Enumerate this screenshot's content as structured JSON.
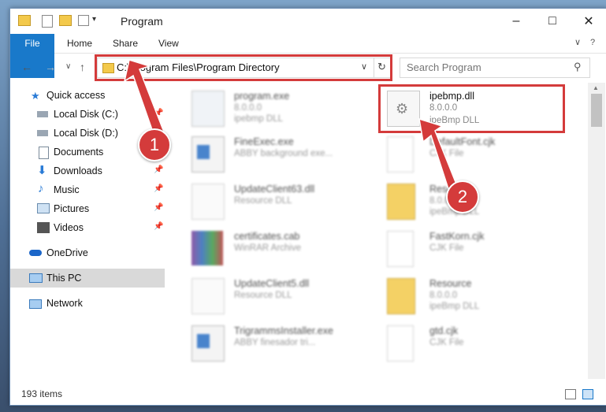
{
  "window": {
    "title": "Program"
  },
  "ribbon": {
    "tabs": [
      "File",
      "Home",
      "Share",
      "View"
    ]
  },
  "address": {
    "path": "C:\\Program Files\\Program Directory"
  },
  "search": {
    "placeholder": "Search Program"
  },
  "nav": {
    "items": [
      {
        "label": "Quick access"
      },
      {
        "label": "Local Disk (C:)"
      },
      {
        "label": "Local Disk (D:)"
      },
      {
        "label": "Documents"
      },
      {
        "label": "Downloads"
      },
      {
        "label": "Music"
      },
      {
        "label": "Pictures"
      },
      {
        "label": "Videos"
      },
      {
        "label": "OneDrive"
      },
      {
        "label": "This PC"
      },
      {
        "label": "Network"
      }
    ]
  },
  "files": {
    "left": [
      {
        "name": "program.exe",
        "line1": "8.0.0.0",
        "line2": "ipebmp DLL"
      },
      {
        "name": "FineExec.exe",
        "line1": "ABBY background exe..."
      },
      {
        "name": "UpdateClient63.dll",
        "line1": "Resource DLL"
      },
      {
        "name": "certificates.cab",
        "line1": "WinRAR Archive"
      },
      {
        "name": "UpdateClient5.dll",
        "line1": "Resource DLL"
      },
      {
        "name": "TrigrammsInstaller.exe",
        "line1": "ABBY finesador tri..."
      }
    ],
    "right": [
      {
        "name": "ipebmp.dll",
        "line1": "8.0.0.0",
        "line2": "ipeBmp DLL"
      },
      {
        "name": "DefaultFont.cjk",
        "line1": "CJK File"
      },
      {
        "name": "Resource",
        "line1": "8.0.0.0",
        "line2": "ipeBmp DLL"
      },
      {
        "name": "FastKorn.cjk",
        "line1": "CJK File"
      },
      {
        "name": "Resource",
        "line1": "8.0.0.0",
        "line2": "ipeBmp DLL"
      },
      {
        "name": "gtd.cjk",
        "line1": "CJK File"
      }
    ]
  },
  "status": {
    "count": "193 items"
  },
  "annotations": {
    "badge1": "1",
    "badge2": "2"
  },
  "colors": {
    "accent": "#1979ca",
    "annotation": "#d43b3b"
  }
}
